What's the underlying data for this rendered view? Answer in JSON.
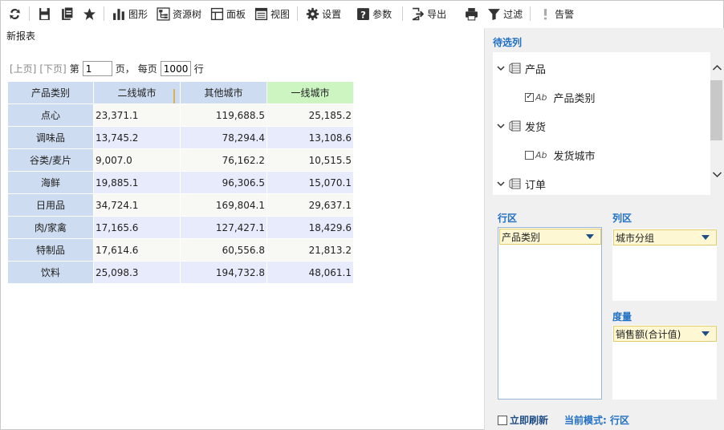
{
  "toolbar": {
    "chart": "图形",
    "resource_tree": "资源树",
    "panel": "面板",
    "view": "视图",
    "settings": "设置",
    "params": "参数",
    "export": "导出",
    "filter": "过滤",
    "alert": "告警"
  },
  "report": {
    "title": "新报表"
  },
  "pager": {
    "prev": "[上页]",
    "next": "[下页]",
    "page_prefix": "第",
    "page_value": "1",
    "page_suffix": "页，",
    "per_page_prefix": "每页",
    "per_page_value": "1000",
    "per_page_suffix": "行"
  },
  "table": {
    "headers": [
      "产品类别",
      "二线城市",
      "其他城市",
      "一线城市"
    ],
    "rows": [
      {
        "category": "点心",
        "tier2": "23,371.1",
        "other": "119,688.5",
        "tier1": "25,185.2"
      },
      {
        "category": "调味品",
        "tier2": "13,745.2",
        "other": "78,294.4",
        "tier1": "13,108.6"
      },
      {
        "category": "谷类/麦片",
        "tier2": "9,007.0",
        "other": "76,162.2",
        "tier1": "10,515.5"
      },
      {
        "category": "海鲜",
        "tier2": "19,885.1",
        "other": "96,306.5",
        "tier1": "15,070.1"
      },
      {
        "category": "日用品",
        "tier2": "34,724.1",
        "other": "169,804.1",
        "tier1": "29,637.1"
      },
      {
        "category": "肉/家禽",
        "tier2": "17,165.6",
        "other": "127,427.1",
        "tier1": "18,429.6"
      },
      {
        "category": "特制品",
        "tier2": "17,614.6",
        "other": "60,556.8",
        "tier1": "21,813.2"
      },
      {
        "category": "饮料",
        "tier2": "25,098.3",
        "other": "194,732.8",
        "tier1": "48,061.1"
      }
    ]
  },
  "panel": {
    "candidates_title": "待选列",
    "tree": [
      {
        "label": "产品",
        "type": "group",
        "expanded": true
      },
      {
        "label": "产品类别",
        "type": "field",
        "checked": true
      },
      {
        "label": "发货",
        "type": "group",
        "expanded": true
      },
      {
        "label": "发货城市",
        "type": "field",
        "checked": false
      },
      {
        "label": "订单",
        "type": "group",
        "expanded": true
      }
    ],
    "field_type_badge": "Ab",
    "rows_title": "行区",
    "rows_field": "产品类别",
    "cols_title": "列区",
    "cols_field": "城市分组",
    "measure_title": "度量",
    "measure_field": "销售额(合计值)",
    "instant_refresh": "立即刷新",
    "instant_refresh_checked": false,
    "mode_label": "当前模式: 行区"
  },
  "colors": {
    "header_bg": "#cddcf0",
    "highlight_header_bg": "#ccf5c2",
    "row_alt_bg": "#e8ebfb",
    "accent": "#1f6fc5"
  }
}
